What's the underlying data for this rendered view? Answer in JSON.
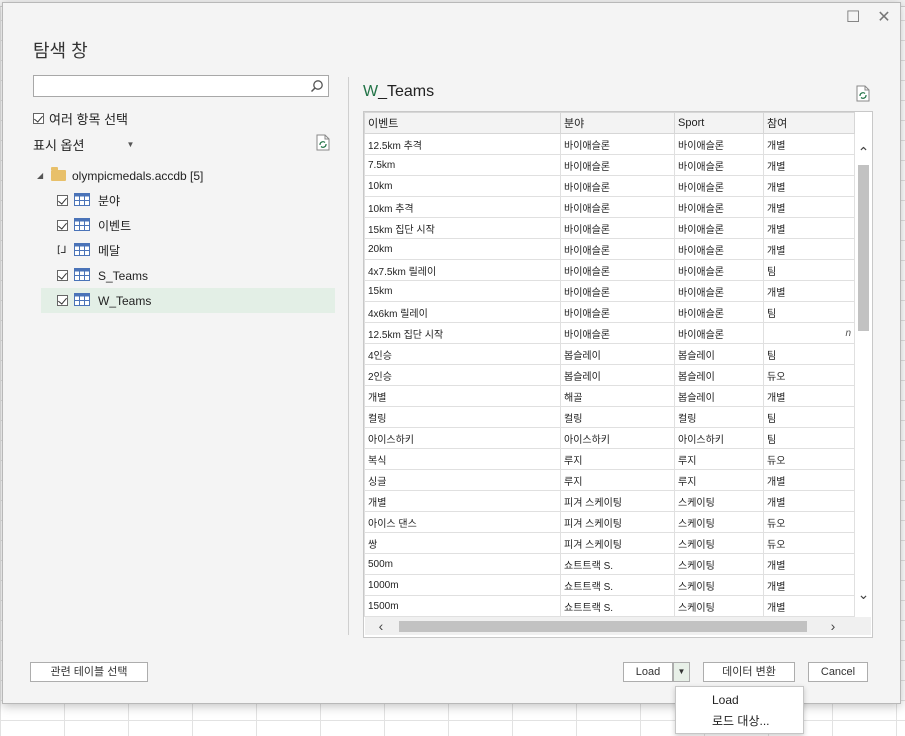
{
  "dialog": {
    "title": "탐색 창"
  },
  "left": {
    "search_value": "",
    "multi_select_label": "여러 항목 선택",
    "display_options_label": "표시 옵션",
    "tree": {
      "root_label": "olympicmedals.accdb [5]",
      "items": [
        {
          "label": "분야",
          "checked": true
        },
        {
          "label": "이벤트",
          "checked": true
        },
        {
          "label": "메달",
          "checked": false,
          "partial_glyph": "[⅃"
        },
        {
          "label": "S_Teams",
          "checked": true
        },
        {
          "label": "W_Teams",
          "checked": true,
          "selected": true
        }
      ]
    }
  },
  "preview": {
    "title_prefix": "W",
    "title_suffix": "_Teams",
    "columns": [
      "이벤트",
      "분야",
      "Sport",
      "참여"
    ],
    "rows": [
      [
        "12.5km 추격",
        "바이애슬론",
        "바이애슬론",
        "개별"
      ],
      [
        "7.5km",
        "바이애슬론",
        "바이애슬론",
        "개별"
      ],
      [
        "10km",
        "바이애슬론",
        "바이애슬론",
        "개별"
      ],
      [
        "10km 추격",
        "바이애슬론",
        "바이애슬론",
        "개별"
      ],
      [
        "15km 집단 시작",
        "바이애슬론",
        "바이애슬론",
        "개별"
      ],
      [
        "20km",
        "바이애슬론",
        "바이애슬론",
        "개별"
      ],
      [
        "4x7.5km 릴레이",
        "바이애슬론",
        "바이애슬론",
        "팀"
      ],
      [
        "15km",
        "바이애슬론",
        "바이애슬론",
        "개별"
      ],
      [
        "4x6km 릴레이",
        "바이애슬론",
        "바이애슬론",
        "팀"
      ],
      [
        "12.5km 집단 시작",
        "바이애슬론",
        "바이애슬론",
        "n"
      ],
      [
        "4인승",
        "봅슬레이",
        "봅슬레이",
        "팀"
      ],
      [
        "2인승",
        "봅슬레이",
        "봅슬레이",
        "듀오"
      ],
      [
        "개별",
        "해골",
        "봅슬레이",
        "개별"
      ],
      [
        "컬링",
        "컬링",
        "컬링",
        "팀"
      ],
      [
        "아이스하키",
        "아이스하키",
        "아이스하키",
        "팀"
      ],
      [
        "복식",
        "루지",
        "루지",
        "듀오"
      ],
      [
        "싱글",
        "루지",
        "루지",
        "개별"
      ],
      [
        "개별",
        "피겨 스케이팅",
        "스케이팅",
        "개별"
      ],
      [
        "아이스 댄스",
        "피겨 스케이팅",
        "스케이팅",
        "듀오"
      ],
      [
        "쌍",
        "피겨 스케이팅",
        "스케이팅",
        "듀오"
      ],
      [
        "500m",
        "쇼트트랙 S.",
        "스케이팅",
        "개별"
      ],
      [
        "1000m",
        "쇼트트랙 S.",
        "스케이팅",
        "개별"
      ],
      [
        "1500m",
        "쇼트트랙 S.",
        "스케이팅",
        "개별"
      ]
    ]
  },
  "footer": {
    "related_tables_label": "관련 테이블 선택",
    "load_label": "Load",
    "transform_label": "데이터 변환",
    "cancel_label": "Cancel"
  },
  "load_menu": {
    "item_load": "Load",
    "item_load_to": "로드 대상..."
  },
  "colors": {
    "accent_green": "#217346",
    "selected_row": "#e3efe6"
  }
}
